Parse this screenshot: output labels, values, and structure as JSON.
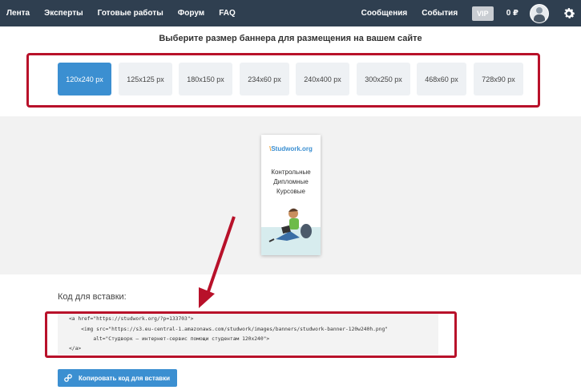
{
  "nav": {
    "left": [
      "Лента",
      "Эксперты",
      "Готовые работы",
      "Форум",
      "FAQ"
    ],
    "messages": "Сообщения",
    "events": "События",
    "vip": "VIP",
    "balance": "0 ₽"
  },
  "title": "Выберите размер баннера для размещения на вашем сайте",
  "sizes": [
    "120x240 px",
    "125x125 px",
    "180x150 px",
    "234x60 px",
    "240x400 px",
    "300x250 px",
    "468x60 px",
    "728x90 px"
  ],
  "active_size": "120x240 px",
  "banner": {
    "logo_mark": "\\",
    "logo_text": "Studwork.org",
    "lines": [
      "Контрольные",
      "Дипломные",
      "Курсовые"
    ]
  },
  "code": {
    "label": "Код для вставки:",
    "lines": [
      "<a href=\"https://studwork.org/?p=133703\">",
      "    <img src=\"https://s3.eu-central-1.amazonaws.com/studwork/images/banners/studwork-banner-120w240h.png\"",
      "        alt=\"Студворк — интернет-сервис помощи студентам 120x240\">",
      "</a>"
    ]
  },
  "copy_button": "Копировать код для вставки",
  "colors": {
    "nav": "#2f3f50",
    "accent": "#3b8fd1",
    "highlight": "#b8112a"
  }
}
